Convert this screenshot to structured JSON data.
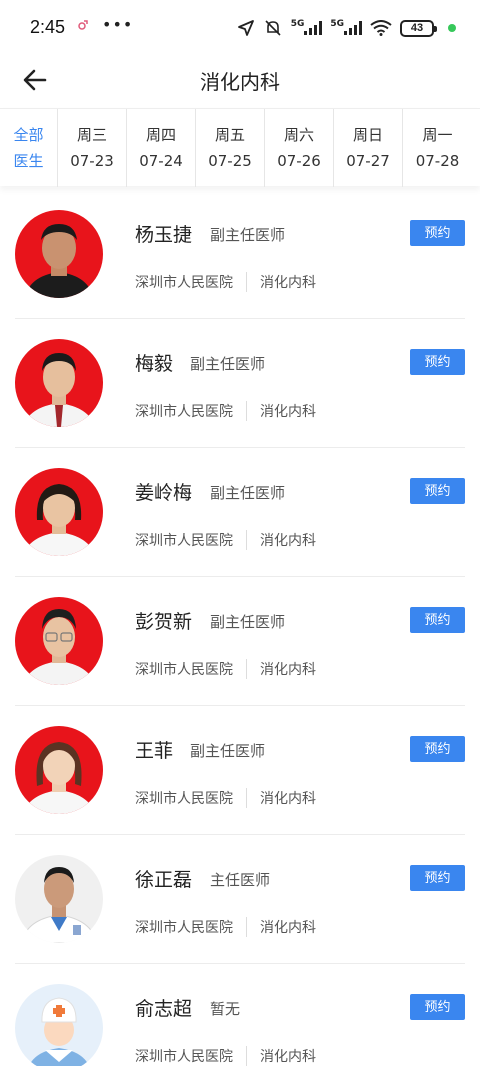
{
  "status": {
    "time": "2:45",
    "battery": "43",
    "net1": "5G",
    "net2": "5G"
  },
  "header": {
    "title": "消化内科"
  },
  "date_tabs": {
    "all_line1": "全部",
    "all_line2": "医生",
    "days": [
      {
        "weekday": "周三",
        "date": "07-23"
      },
      {
        "weekday": "周四",
        "date": "07-24"
      },
      {
        "weekday": "周五",
        "date": "07-25"
      },
      {
        "weekday": "周六",
        "date": "07-26"
      },
      {
        "weekday": "周日",
        "date": "07-27"
      },
      {
        "weekday": "周一",
        "date": "07-28"
      }
    ]
  },
  "doctors": [
    {
      "name": "杨玉捷",
      "title": "副主任医师",
      "hospital": "深圳市人民医院",
      "dept": "消化内科",
      "book": "预约"
    },
    {
      "name": "梅毅",
      "title": "副主任医师",
      "hospital": "深圳市人民医院",
      "dept": "消化内科",
      "book": "预约"
    },
    {
      "name": "姜岭梅",
      "title": "副主任医师",
      "hospital": "深圳市人民医院",
      "dept": "消化内科",
      "book": "预约"
    },
    {
      "name": "彭贺新",
      "title": "副主任医师",
      "hospital": "深圳市人民医院",
      "dept": "消化内科",
      "book": "预约"
    },
    {
      "name": "王菲",
      "title": "副主任医师",
      "hospital": "深圳市人民医院",
      "dept": "消化内科",
      "book": "预约"
    },
    {
      "name": "徐正磊",
      "title": "主任医师",
      "hospital": "深圳市人民医院",
      "dept": "消化内科",
      "book": "预约"
    },
    {
      "name": "俞志超",
      "title": "暂无",
      "hospital": "深圳市人民医院",
      "dept": "消化内科",
      "book": "预约"
    }
  ],
  "colors": {
    "accent": "#3a86ef",
    "portrait_bg": "#e8141b"
  }
}
